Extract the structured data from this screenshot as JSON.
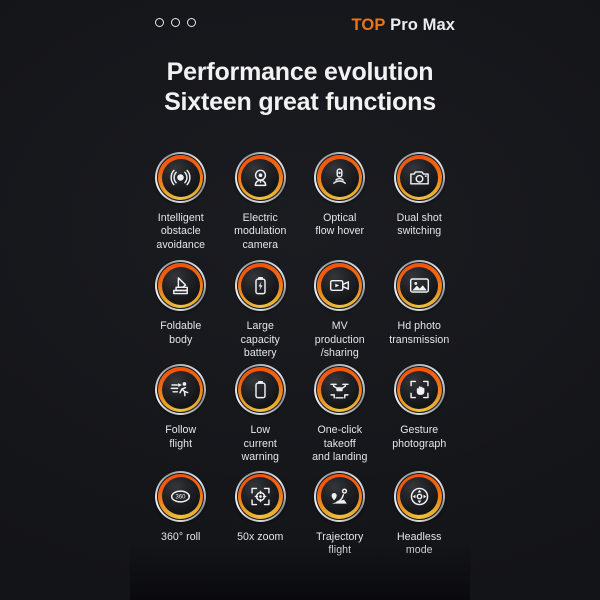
{
  "theme": {
    "background": "#141519",
    "accent_orange": "#e8761a",
    "ring_orange": "#f1530c",
    "ring_gold": "#f0c23a",
    "text_primary": "#f2f2f3",
    "text_label": "#e6e6e8"
  },
  "topbar": {
    "dots_count": 3,
    "brand_highlight": "TOP",
    "brand_rest": " Pro Max"
  },
  "headline": {
    "line1": "Performance evolution",
    "line2": "Sixteen great functions"
  },
  "features": [
    {
      "icon": "obstacle-avoidance-sensor-icon",
      "label": "Intelligent\nobstacle\navoidance"
    },
    {
      "icon": "webcam-icon",
      "label": "Electric\nmodulation\ncamera"
    },
    {
      "icon": "optical-flow-sensor-icon",
      "label": "Optical\nflow hover"
    },
    {
      "icon": "camera-icon",
      "label": "Dual shot\nswitching"
    },
    {
      "icon": "foldable-arm-icon",
      "label": "Foldable\nbody"
    },
    {
      "icon": "battery-bolt-icon",
      "label": "Large\ncapacity\nbattery"
    },
    {
      "icon": "video-clip-icon",
      "label": "MV\nproduction\n/sharing"
    },
    {
      "icon": "photo-image-icon",
      "label": "Hd photo\ntransmission"
    },
    {
      "icon": "running-person-follow-icon",
      "label": "Follow\nflight"
    },
    {
      "icon": "battery-low-icon",
      "label": "Low\ncurrent\nwarning"
    },
    {
      "icon": "drone-takeoff-landing-icon",
      "label": "One-click\ntakeoff\nand landing"
    },
    {
      "icon": "hand-gesture-frame-icon",
      "label": "Gesture\nphotograph"
    },
    {
      "icon": "360-rotation-icon",
      "label": "360°  roll"
    },
    {
      "icon": "zoom-focus-frame-icon",
      "label": "50x zoom"
    },
    {
      "icon": "trajectory-path-icon",
      "label": "Trajectory\nflight"
    },
    {
      "icon": "headless-compass-icon",
      "label": "Headless\nmode"
    }
  ]
}
